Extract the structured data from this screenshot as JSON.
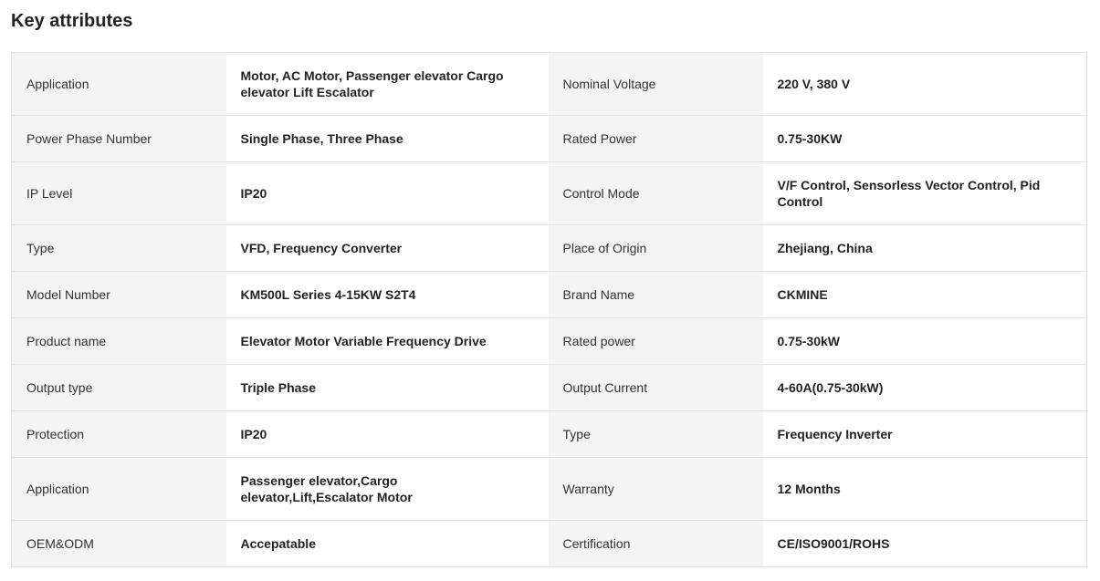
{
  "section": {
    "title": "Key attributes"
  },
  "attributes": [
    [
      {
        "label": "Application",
        "value": "Motor, AC Motor, Passenger elevator Cargo elevator Lift Escalator"
      },
      {
        "label": "Nominal Voltage",
        "value": "220 V, 380 V"
      }
    ],
    [
      {
        "label": "Power Phase Number",
        "value": "Single Phase, Three Phase"
      },
      {
        "label": "Rated Power",
        "value": "0.75-30KW"
      }
    ],
    [
      {
        "label": "IP Level",
        "value": "IP20"
      },
      {
        "label": "Control Mode",
        "value": "V/F Control, Sensorless Vector Control, Pid Control"
      }
    ],
    [
      {
        "label": "Type",
        "value": "VFD, Frequency Converter"
      },
      {
        "label": "Place of Origin",
        "value": "Zhejiang, China"
      }
    ],
    [
      {
        "label": "Model Number",
        "value": "KM500L Series 4-15KW S2T4"
      },
      {
        "label": "Brand Name",
        "value": "CKMINE"
      }
    ],
    [
      {
        "label": "Product name",
        "value": "Elevator Motor Variable Frequency Drive"
      },
      {
        "label": "Rated power",
        "value": "0.75-30kW"
      }
    ],
    [
      {
        "label": "Output type",
        "value": "Triple Phase"
      },
      {
        "label": "Output Current",
        "value": "4-60A(0.75-30kW)"
      }
    ],
    [
      {
        "label": "Protection",
        "value": "IP20"
      },
      {
        "label": "Type",
        "value": "Frequency Inverter"
      }
    ],
    [
      {
        "label": "Application",
        "value": "Passenger elevator,Cargo elevator,Lift,Escalator Motor"
      },
      {
        "label": "Warranty",
        "value": "12 Months"
      }
    ],
    [
      {
        "label": "OEM&ODM",
        "value": "Accepatable"
      },
      {
        "label": "Certification",
        "value": "CE/ISO9001/ROHS"
      }
    ]
  ]
}
